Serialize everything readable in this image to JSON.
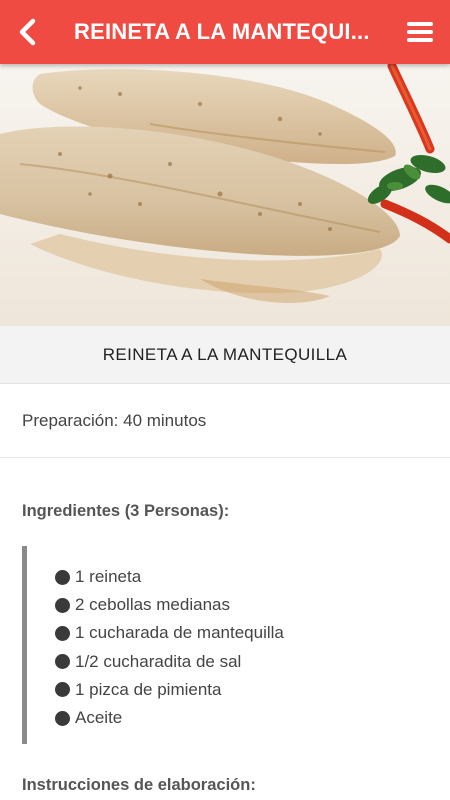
{
  "header": {
    "title": "REINETA A LA MANTEQUI...",
    "back_icon": "chevron-left-icon",
    "menu_icon": "hamburger-menu-icon",
    "background_color": "#ef4b43"
  },
  "recipe": {
    "title": "REINETA A LA MANTEQUILLA",
    "preparation": "Preparación: 40 minutos",
    "ingredients_heading": "Ingredientes (3 Personas):",
    "ingredients": [
      "1 reineta",
      "2 cebollas medianas",
      "1 cucharada de mantequilla",
      "1/2 cucharadita de sal",
      "1 pizca de pimienta",
      "Aceite"
    ],
    "instructions_heading": "Instrucciones de elaboración:"
  }
}
